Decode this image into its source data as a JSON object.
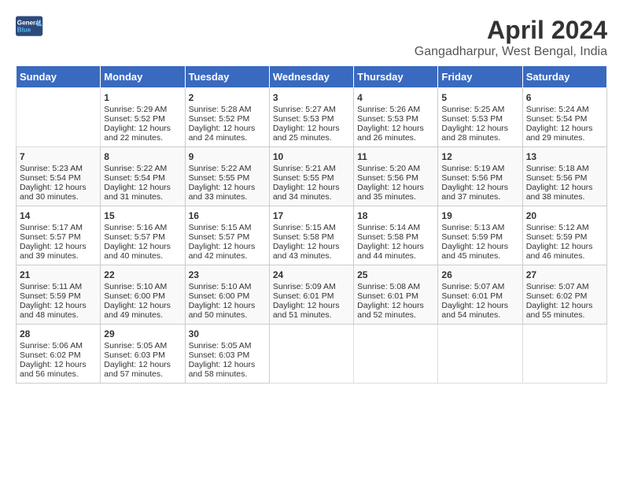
{
  "header": {
    "logo_general": "General",
    "logo_blue": "Blue",
    "title": "April 2024",
    "subtitle": "Gangadharpur, West Bengal, India"
  },
  "columns": [
    "Sunday",
    "Monday",
    "Tuesday",
    "Wednesday",
    "Thursday",
    "Friday",
    "Saturday"
  ],
  "weeks": [
    [
      {
        "day": "",
        "info": ""
      },
      {
        "day": "1",
        "info": "Sunrise: 5:29 AM\nSunset: 5:52 PM\nDaylight: 12 hours\nand 22 minutes."
      },
      {
        "day": "2",
        "info": "Sunrise: 5:28 AM\nSunset: 5:52 PM\nDaylight: 12 hours\nand 24 minutes."
      },
      {
        "day": "3",
        "info": "Sunrise: 5:27 AM\nSunset: 5:53 PM\nDaylight: 12 hours\nand 25 minutes."
      },
      {
        "day": "4",
        "info": "Sunrise: 5:26 AM\nSunset: 5:53 PM\nDaylight: 12 hours\nand 26 minutes."
      },
      {
        "day": "5",
        "info": "Sunrise: 5:25 AM\nSunset: 5:53 PM\nDaylight: 12 hours\nand 28 minutes."
      },
      {
        "day": "6",
        "info": "Sunrise: 5:24 AM\nSunset: 5:54 PM\nDaylight: 12 hours\nand 29 minutes."
      }
    ],
    [
      {
        "day": "7",
        "info": "Sunrise: 5:23 AM\nSunset: 5:54 PM\nDaylight: 12 hours\nand 30 minutes."
      },
      {
        "day": "8",
        "info": "Sunrise: 5:22 AM\nSunset: 5:54 PM\nDaylight: 12 hours\nand 31 minutes."
      },
      {
        "day": "9",
        "info": "Sunrise: 5:22 AM\nSunset: 5:55 PM\nDaylight: 12 hours\nand 33 minutes."
      },
      {
        "day": "10",
        "info": "Sunrise: 5:21 AM\nSunset: 5:55 PM\nDaylight: 12 hours\nand 34 minutes."
      },
      {
        "day": "11",
        "info": "Sunrise: 5:20 AM\nSunset: 5:56 PM\nDaylight: 12 hours\nand 35 minutes."
      },
      {
        "day": "12",
        "info": "Sunrise: 5:19 AM\nSunset: 5:56 PM\nDaylight: 12 hours\nand 37 minutes."
      },
      {
        "day": "13",
        "info": "Sunrise: 5:18 AM\nSunset: 5:56 PM\nDaylight: 12 hours\nand 38 minutes."
      }
    ],
    [
      {
        "day": "14",
        "info": "Sunrise: 5:17 AM\nSunset: 5:57 PM\nDaylight: 12 hours\nand 39 minutes."
      },
      {
        "day": "15",
        "info": "Sunrise: 5:16 AM\nSunset: 5:57 PM\nDaylight: 12 hours\nand 40 minutes."
      },
      {
        "day": "16",
        "info": "Sunrise: 5:15 AM\nSunset: 5:57 PM\nDaylight: 12 hours\nand 42 minutes."
      },
      {
        "day": "17",
        "info": "Sunrise: 5:15 AM\nSunset: 5:58 PM\nDaylight: 12 hours\nand 43 minutes."
      },
      {
        "day": "18",
        "info": "Sunrise: 5:14 AM\nSunset: 5:58 PM\nDaylight: 12 hours\nand 44 minutes."
      },
      {
        "day": "19",
        "info": "Sunrise: 5:13 AM\nSunset: 5:59 PM\nDaylight: 12 hours\nand 45 minutes."
      },
      {
        "day": "20",
        "info": "Sunrise: 5:12 AM\nSunset: 5:59 PM\nDaylight: 12 hours\nand 46 minutes."
      }
    ],
    [
      {
        "day": "21",
        "info": "Sunrise: 5:11 AM\nSunset: 5:59 PM\nDaylight: 12 hours\nand 48 minutes."
      },
      {
        "day": "22",
        "info": "Sunrise: 5:10 AM\nSunset: 6:00 PM\nDaylight: 12 hours\nand 49 minutes."
      },
      {
        "day": "23",
        "info": "Sunrise: 5:10 AM\nSunset: 6:00 PM\nDaylight: 12 hours\nand 50 minutes."
      },
      {
        "day": "24",
        "info": "Sunrise: 5:09 AM\nSunset: 6:01 PM\nDaylight: 12 hours\nand 51 minutes."
      },
      {
        "day": "25",
        "info": "Sunrise: 5:08 AM\nSunset: 6:01 PM\nDaylight: 12 hours\nand 52 minutes."
      },
      {
        "day": "26",
        "info": "Sunrise: 5:07 AM\nSunset: 6:01 PM\nDaylight: 12 hours\nand 54 minutes."
      },
      {
        "day": "27",
        "info": "Sunrise: 5:07 AM\nSunset: 6:02 PM\nDaylight: 12 hours\nand 55 minutes."
      }
    ],
    [
      {
        "day": "28",
        "info": "Sunrise: 5:06 AM\nSunset: 6:02 PM\nDaylight: 12 hours\nand 56 minutes."
      },
      {
        "day": "29",
        "info": "Sunrise: 5:05 AM\nSunset: 6:03 PM\nDaylight: 12 hours\nand 57 minutes."
      },
      {
        "day": "30",
        "info": "Sunrise: 5:05 AM\nSunset: 6:03 PM\nDaylight: 12 hours\nand 58 minutes."
      },
      {
        "day": "",
        "info": ""
      },
      {
        "day": "",
        "info": ""
      },
      {
        "day": "",
        "info": ""
      },
      {
        "day": "",
        "info": ""
      }
    ]
  ]
}
